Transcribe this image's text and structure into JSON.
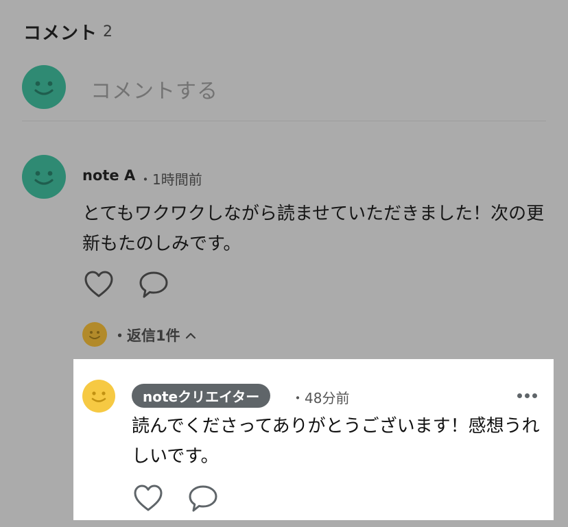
{
  "comments_header": {
    "title": "コメント",
    "count": "2"
  },
  "comment_input": {
    "placeholder": "コメントする"
  },
  "comment": {
    "author": "note A",
    "time": "・1時間前",
    "body": "とてもワクワクしながら読ませていただきました！次の更新もたのしみです。",
    "actions": [
      "heart-icon",
      "comment-bubble-icon"
    ],
    "reply_summary": "・返信1件",
    "reply_toggle_icon": "chevron-up-icon"
  },
  "reply": {
    "badge": "noteクリエイター",
    "time": "・48分前",
    "body": "読んでくださってありがとうございます！感想うれしいです。",
    "actions": [
      "heart-icon",
      "comment-bubble-icon"
    ],
    "menu_icon": "more-icon"
  },
  "colors": {
    "overlay_bg": "#ababab",
    "avatar_teal": "#2f8a73",
    "avatar_yellow": "#f6c943",
    "badge_bg": "#5f6569"
  }
}
